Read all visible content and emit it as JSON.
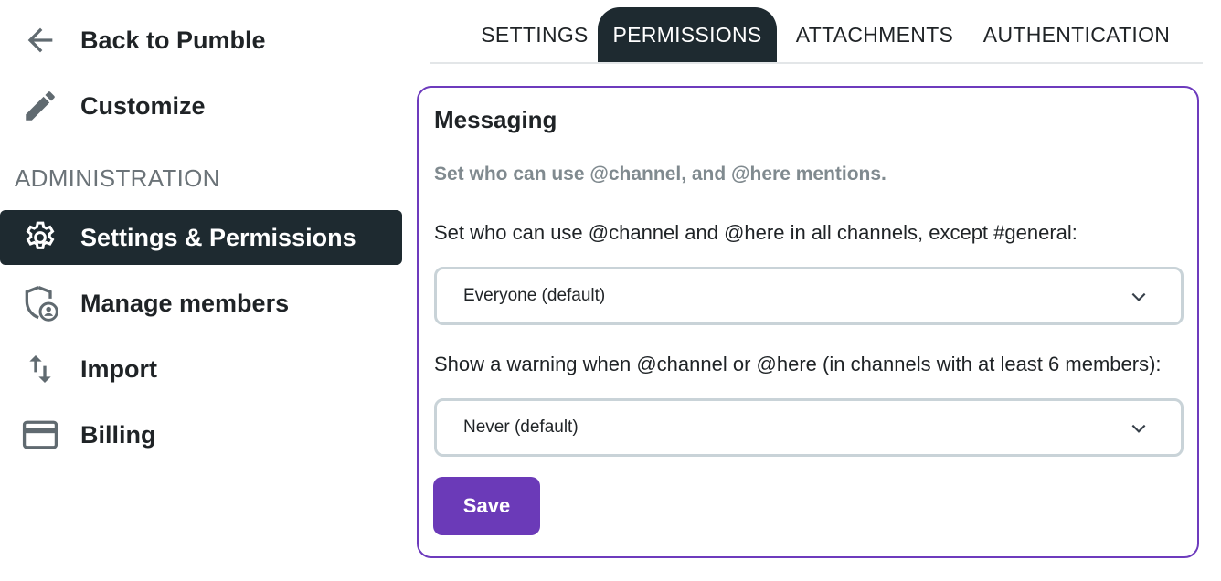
{
  "sidebar": {
    "back": {
      "label": "Back to Pumble",
      "icon": "arrow-left-icon"
    },
    "customize": {
      "label": "Customize",
      "icon": "pencil-icon"
    },
    "section_label": "ADMINISTRATION",
    "items": [
      {
        "label": "Settings & Permissions",
        "icon": "gear-icon",
        "active": true
      },
      {
        "label": "Manage members",
        "icon": "shield-user-icon",
        "active": false
      },
      {
        "label": "Import",
        "icon": "swap-vertical-icon",
        "active": false
      },
      {
        "label": "Billing",
        "icon": "credit-card-icon",
        "active": false
      }
    ]
  },
  "tabs": [
    {
      "label": "SETTINGS",
      "active": false
    },
    {
      "label": "PERMISSIONS",
      "active": true
    },
    {
      "label": "ATTACHMENTS",
      "active": false
    },
    {
      "label": "AUTHENTICATION",
      "active": false
    }
  ],
  "card": {
    "title": "Messaging",
    "description": "Set who can use @channel, and @here mentions.",
    "fields": [
      {
        "label": "Set who can use @channel and @here in all channels, except #general:",
        "value": "Everyone (default)"
      },
      {
        "label": "Show a warning when @channel or @here (in channels with at least 6 members):",
        "value": "Never (default)"
      }
    ],
    "save_label": "Save"
  },
  "colors": {
    "accent": "#6b3ab8",
    "active_bg": "#1e2a30",
    "muted_text": "#808a8f",
    "select_border": "#c9d3d8"
  }
}
